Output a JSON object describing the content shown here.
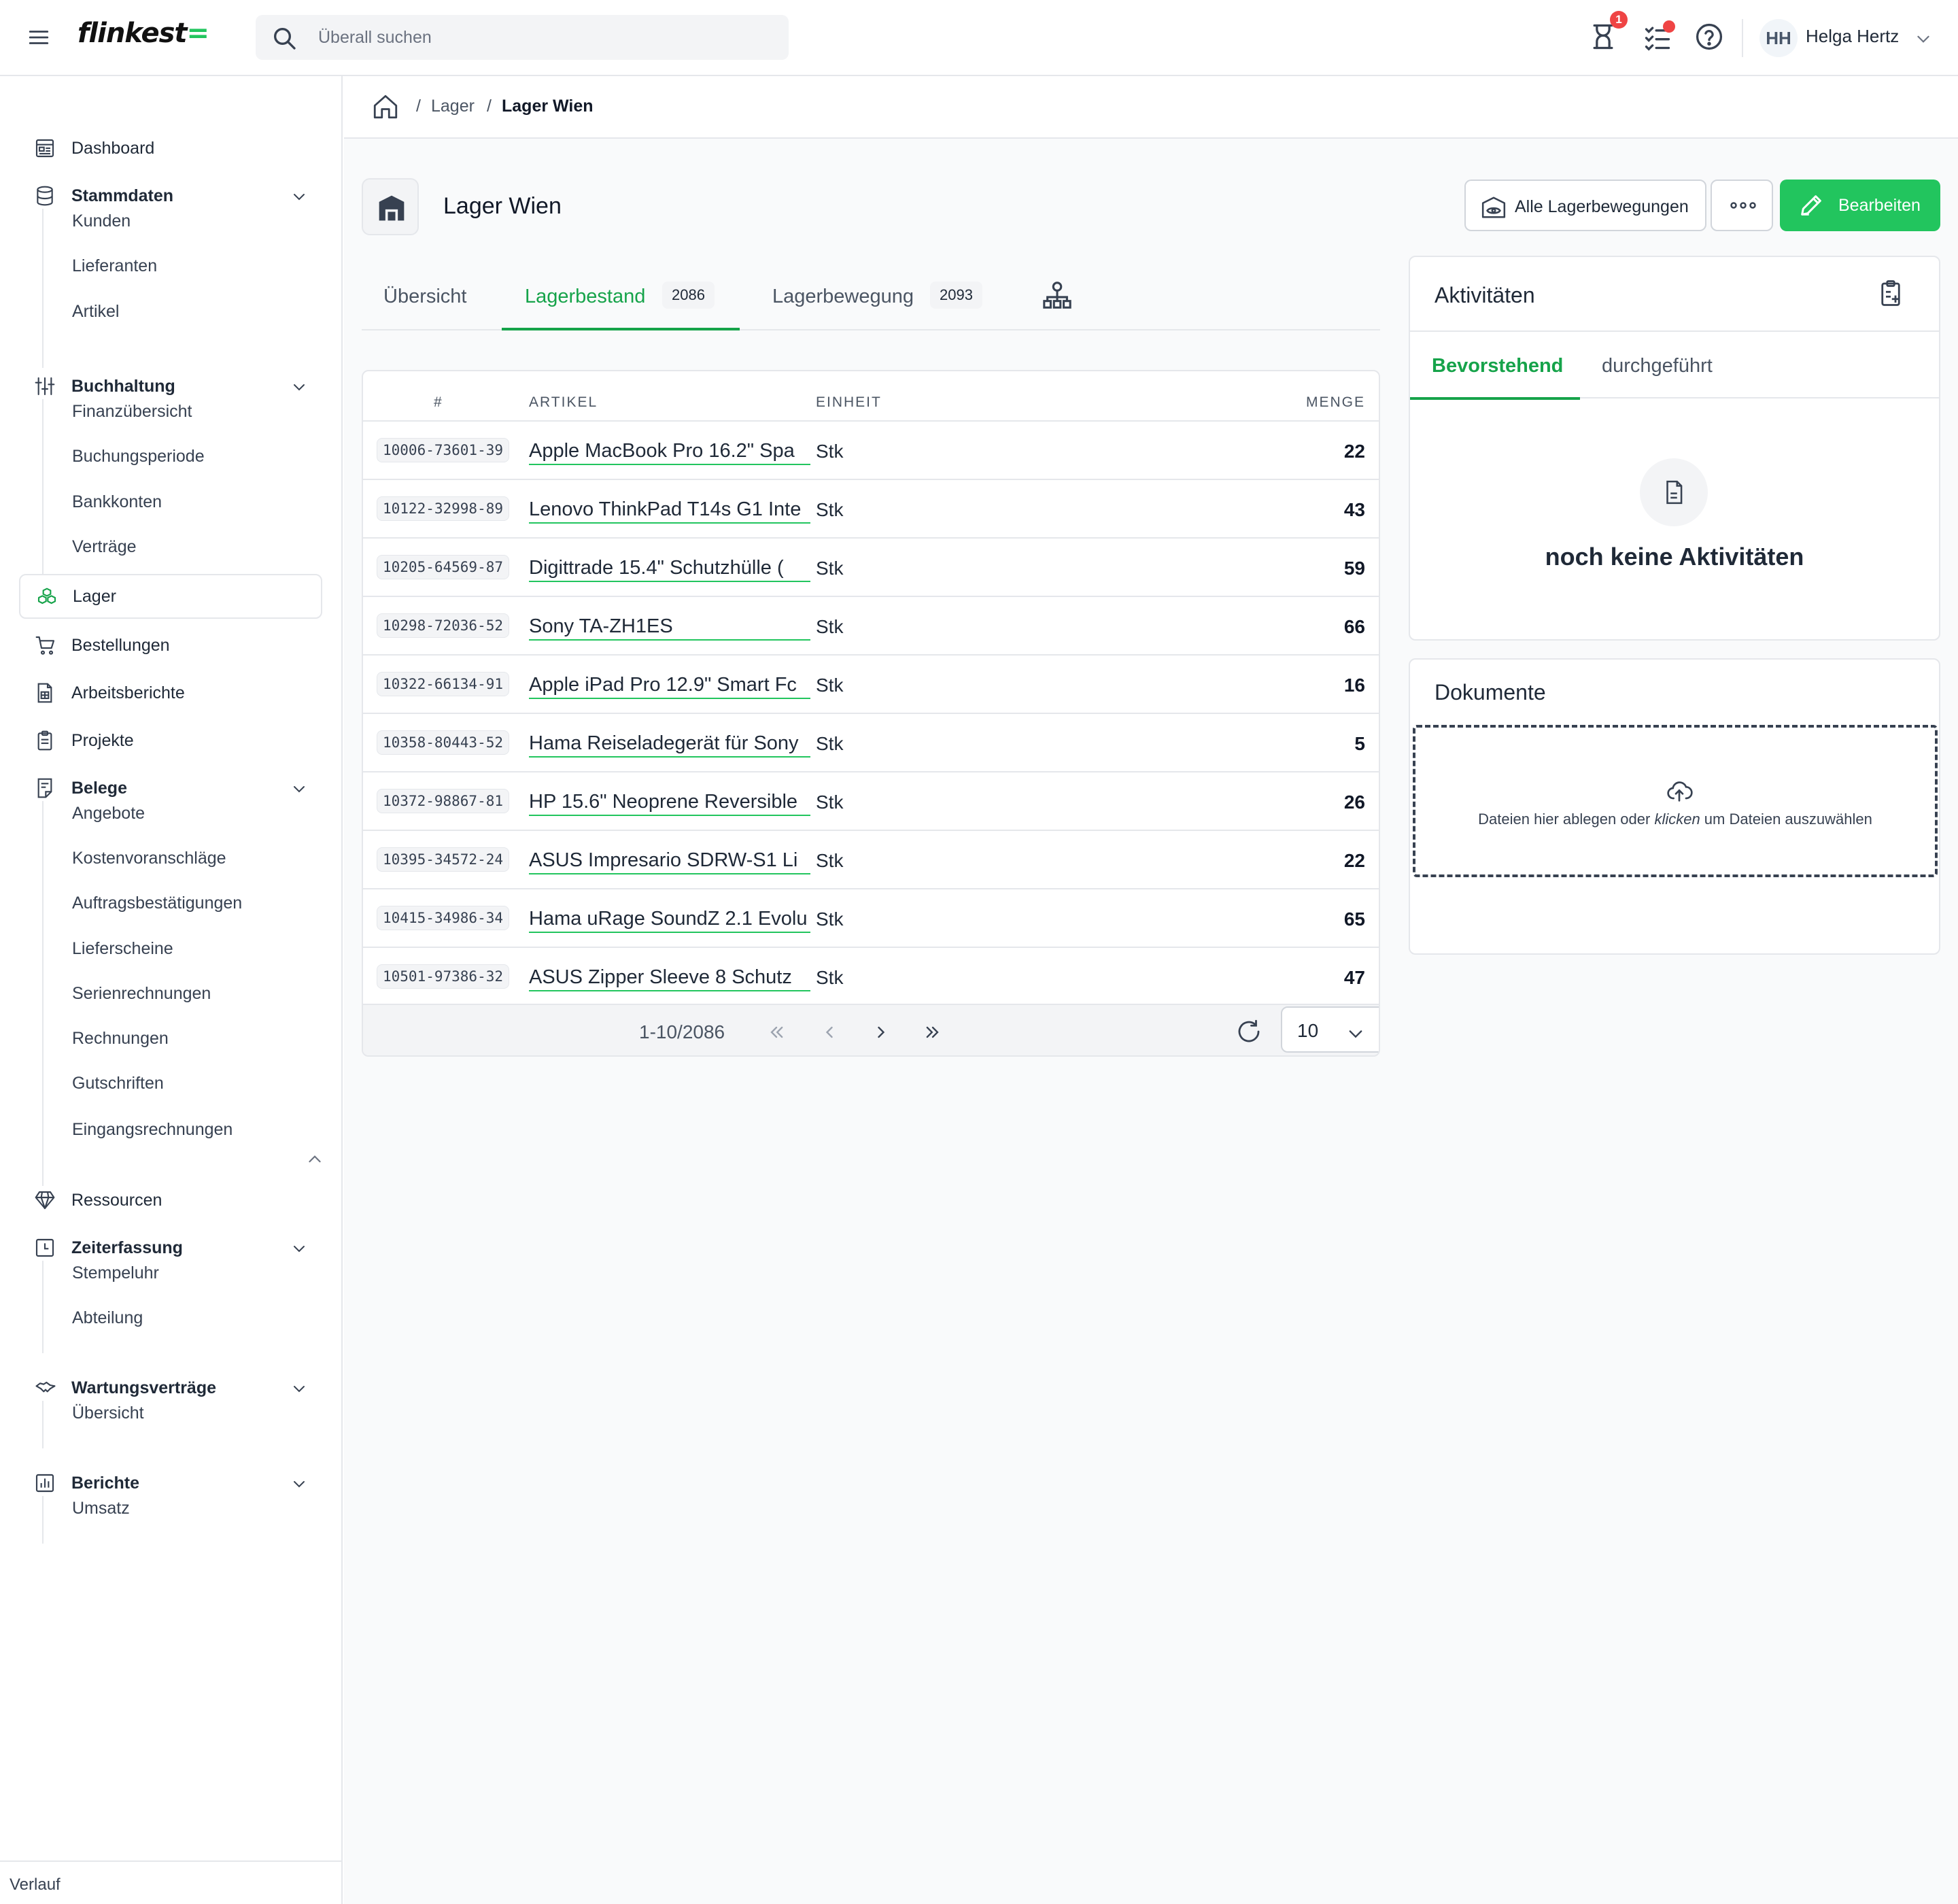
{
  "app": {
    "logo_text": "flinkest",
    "search_placeholder": "Überall suchen",
    "notification_badge": "1",
    "user": {
      "initials": "HH",
      "name": "Helga Hertz"
    }
  },
  "sidebar": {
    "items": [
      {
        "label": "Dashboard"
      },
      {
        "label": "Stammdaten",
        "children": [
          "Kunden",
          "Lieferanten",
          "Artikel"
        ]
      },
      {
        "label": "Buchhaltung",
        "children": [
          "Finanzübersicht",
          "Buchungsperiode",
          "Bankkonten",
          "Verträge"
        ]
      },
      {
        "label": "Lager"
      },
      {
        "label": "Bestellungen"
      },
      {
        "label": "Arbeitsberichte"
      },
      {
        "label": "Projekte"
      },
      {
        "label": "Belege",
        "children": [
          "Angebote",
          "Kostenvoranschläge",
          "Auftragsbestätigungen",
          "Lieferscheine",
          "Serienrechnungen",
          "Rechnungen",
          "Gutschriften",
          "Eingangsrechnungen"
        ]
      },
      {
        "label": "Ressourcen"
      },
      {
        "label": "Zeiterfassung",
        "children": [
          "Stempeluhr",
          "Abteilung"
        ]
      },
      {
        "label": "Wartungsverträge",
        "children": [
          "Übersicht"
        ]
      },
      {
        "label": "Berichte",
        "children": [
          "Umsatz"
        ]
      }
    ],
    "footer": "Verlauf"
  },
  "breadcrumb": [
    "Lager",
    "Lager Wien"
  ],
  "page": {
    "title": "Lager Wien",
    "btn_movements": "Alle Lagerbewegungen",
    "btn_edit": "Bearbeiten"
  },
  "tabs": [
    {
      "label": "Übersicht"
    },
    {
      "label": "Lagerbestand",
      "count": "2086"
    },
    {
      "label": "Lagerbewegung",
      "count": "2093"
    }
  ],
  "table": {
    "columns": [
      "#",
      "ARTIKEL",
      "EINHEIT",
      "MENGE"
    ],
    "rows": [
      {
        "code": "10006-73601-39",
        "article": "Apple MacBook Pro 16.2\" Spa",
        "unit": "Stk",
        "qty": "22"
      },
      {
        "code": "10122-32998-89",
        "article": "Lenovo ThinkPad T14s G1 Inte",
        "unit": "Stk",
        "qty": "43"
      },
      {
        "code": "10205-64569-87",
        "article": "Digittrade 15.4\" Schutzhülle (",
        "unit": "Stk",
        "qty": "59"
      },
      {
        "code": "10298-72036-52",
        "article": "Sony TA-ZH1ES",
        "unit": "Stk",
        "qty": "66"
      },
      {
        "code": "10322-66134-91",
        "article": "Apple iPad Pro 12.9\" Smart Fc",
        "unit": "Stk",
        "qty": "16"
      },
      {
        "code": "10358-80443-52",
        "article": "Hama Reiseladegerät für Sony",
        "unit": "Stk",
        "qty": "5"
      },
      {
        "code": "10372-98867-81",
        "article": "HP 15.6\" Neoprene Reversible",
        "unit": "Stk",
        "qty": "26"
      },
      {
        "code": "10395-34572-24",
        "article": "ASUS Impresario SDRW-S1 Li",
        "unit": "Stk",
        "qty": "22"
      },
      {
        "code": "10415-34986-34",
        "article": "Hama uRage SoundZ 2.1 Evolu",
        "unit": "Stk",
        "qty": "65"
      },
      {
        "code": "10501-97386-32",
        "article": "ASUS Zipper Sleeve 8 Schutz",
        "unit": "Stk",
        "qty": "47"
      }
    ],
    "pagination": {
      "range": "1-10/2086",
      "page_size": "10"
    }
  },
  "activities": {
    "title": "Aktivitäten",
    "tabs": [
      "Bevorstehend",
      "durchgeführt"
    ],
    "empty": "noch keine Aktivitäten"
  },
  "documents": {
    "title": "Dokumente",
    "drop_before": "Dateien hier ablegen oder ",
    "drop_em": "klicken",
    "drop_after": " um Dateien auszuwählen"
  },
  "colors": {
    "accent": "#22c55e",
    "accent_text": "#16a34a",
    "badge": "#ef4444"
  }
}
